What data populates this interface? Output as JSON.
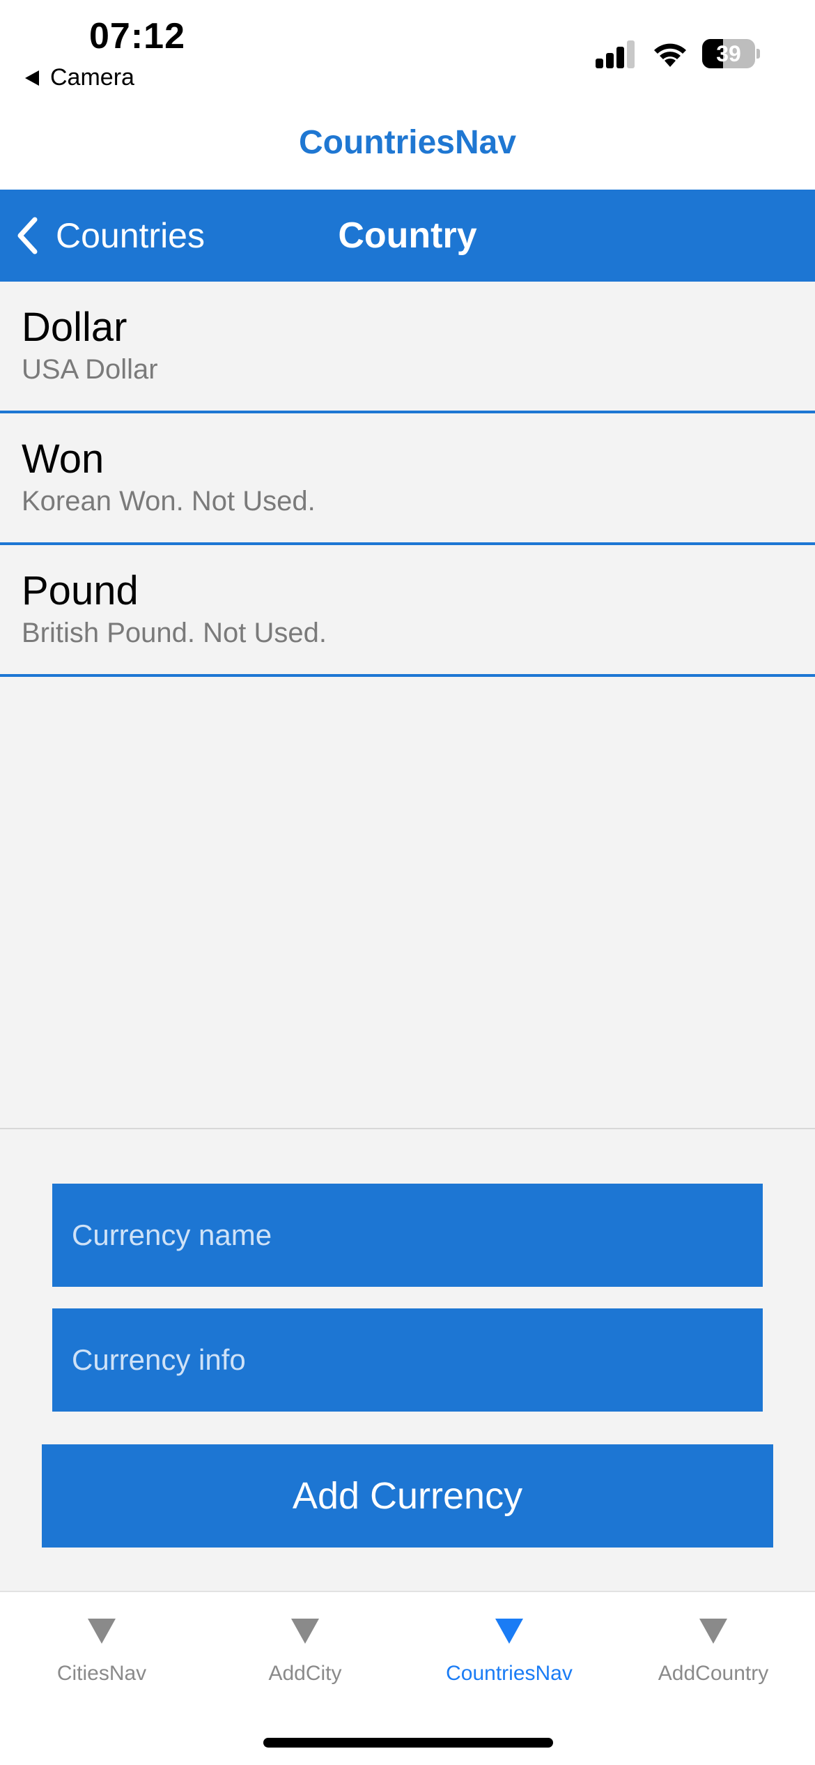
{
  "status_bar": {
    "time": "07:12",
    "back_app": "Camera",
    "battery": "39",
    "battery_level": 0.39
  },
  "app_title": "CountriesNav",
  "navbar": {
    "back_label": "Countries",
    "title": "Country"
  },
  "currencies": [
    {
      "name": "Dollar",
      "info": "USA Dollar"
    },
    {
      "name": "Won",
      "info": "Korean Won. Not Used."
    },
    {
      "name": "Pound",
      "info": "British Pound. Not Used."
    }
  ],
  "form": {
    "name_placeholder": "Currency name",
    "info_placeholder": "Currency info",
    "add_label": "Add Currency"
  },
  "tabs": [
    {
      "label": "CitiesNav",
      "active": false
    },
    {
      "label": "AddCity",
      "active": false
    },
    {
      "label": "CountriesNav",
      "active": true
    },
    {
      "label": "AddCountry",
      "active": false
    }
  ],
  "colors": {
    "accent": "#1d76d3",
    "tab_active": "#1a7cf5",
    "tab_inactive": "#8a8a8a"
  }
}
